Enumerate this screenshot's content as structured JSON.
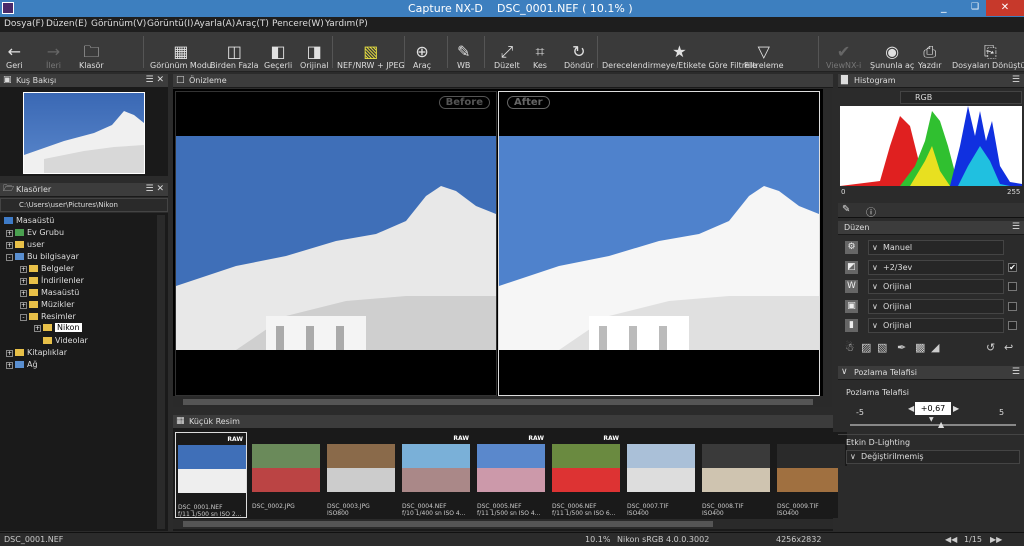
{
  "window": {
    "title": "Capture NX-D",
    "file_title": "DSC_0001.NEF ( 10.1% )",
    "minimize": "_",
    "maximize": "❑",
    "close": "✕"
  },
  "menu": [
    "Dosya(F)",
    "Düzen(E)",
    "Görünüm(V)",
    "Görüntü(I)",
    "Ayarla(A)",
    "Araç(T)",
    "Pencere(W)",
    "Yardım(P)"
  ],
  "toolbar": {
    "back": "Geri",
    "forward": "İleri",
    "folder": "Klasör",
    "view_mode": "Görünüm Modu",
    "multi": "Birden Fazla",
    "current": "Geçerli",
    "original": "Orijinal",
    "nef_jpeg": "NEF/NRW + JPEG",
    "tool": "Araç",
    "wb": "WB",
    "straighten": "Düzelt",
    "crop": "Kes",
    "rotate": "Döndür",
    "filter_rating": "Derecelendirmeye/Etikete Göre Filtrele",
    "filtering": "Filtreleme",
    "viewnx": "ViewNX-i",
    "open_with": "Şununla aç",
    "print": "Yazdır",
    "convert": "Dosyaları Dönüştür"
  },
  "birds_eye": {
    "title": "Kuş Bakışı"
  },
  "folders": {
    "title": "Klasörler",
    "path": "C:\\Users\\user\\Pictures\\Nikon",
    "items": [
      "Masaüstü",
      "Ev Grubu",
      "user",
      "Bu bilgisayar",
      "Belgeler",
      "İndirilenler",
      "Masaüstü",
      "Müzikler",
      "Resimler",
      "Nikon",
      "Videolar",
      "Kitaplıklar",
      "Ağ"
    ]
  },
  "preview": {
    "title": "Önizleme",
    "before": "Before",
    "after": "After"
  },
  "thumbnails": {
    "title": "Küçük Resim",
    "items": [
      {
        "name": "DSC_0001.NEF",
        "info": "f/11 1/500 sn ISO 2...",
        "raw": "RAW"
      },
      {
        "name": "DSC_0002.JPG",
        "info": "",
        "raw": ""
      },
      {
        "name": "DSC_0003.JPG",
        "info": "ISO800",
        "raw": ""
      },
      {
        "name": "DSC_0004.NEF",
        "info": "f/10 1/400 sn ISO 4...",
        "raw": "RAW"
      },
      {
        "name": "DSC_0005.NEF",
        "info": "f/11 1/500 sn ISO 4...",
        "raw": "RAW"
      },
      {
        "name": "DSC_0006.NEF",
        "info": "f/11 1/500 sn ISO 6...",
        "raw": "RAW"
      },
      {
        "name": "DSC_0007.TIF",
        "info": "ISO400",
        "raw": ""
      },
      {
        "name": "DSC_0008.TIF",
        "info": "ISO400",
        "raw": ""
      },
      {
        "name": "DSC_0009.TIF",
        "info": "ISO400",
        "raw": ""
      }
    ]
  },
  "histogram": {
    "title": "Histogram",
    "channel": "RGB",
    "min": "0",
    "max": "255"
  },
  "edit": {
    "title": "Düzen",
    "rows": [
      {
        "value": "Manuel",
        "checked": ""
      },
      {
        "value": "+2/3ev",
        "checked": "✔"
      },
      {
        "value": "Orijinal",
        "checked": ""
      },
      {
        "value": "Orijinal",
        "checked": ""
      },
      {
        "value": "Orijinal",
        "checked": ""
      }
    ]
  },
  "exposure": {
    "title": "Pozlama Telafisi",
    "label": "Pozlama Telafisi",
    "value": "+0,67",
    "min": "-5",
    "zero": "0",
    "max": "5",
    "adl_label": "Etkin D-Lighting",
    "adl_value": "Değiştirilmemiş"
  },
  "status": {
    "file": "DSC_0001.NEF",
    "zoom": "10.1%",
    "profile": "Nikon sRGB 4.0.0.3002",
    "size": "4256x2832",
    "page": "1/15"
  },
  "colors": {
    "titlebar": "#3d7fbf",
    "sky": "#3f6fb8",
    "folder": "#e8c048"
  }
}
